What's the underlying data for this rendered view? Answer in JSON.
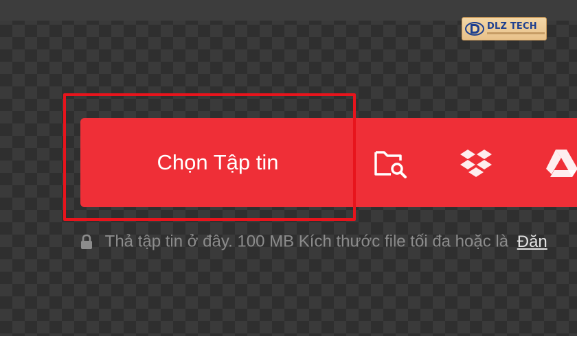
{
  "logo": {
    "brand_text": "DLZ TECH",
    "brand_color": "#1d3f8f"
  },
  "upload": {
    "choose_file_label": "Chọn Tập tin",
    "accent_color": "#ef2f37",
    "sources": [
      {
        "name": "folder-search-icon"
      },
      {
        "name": "dropbox-icon"
      },
      {
        "name": "google-drive-icon"
      }
    ]
  },
  "hint": {
    "text": "Thả tập tin ở đây. 100 MB Kích thước file tối đa hoặc là",
    "link_text": "Đăn"
  },
  "annotation": {
    "highlight_color": "#e8141c"
  }
}
